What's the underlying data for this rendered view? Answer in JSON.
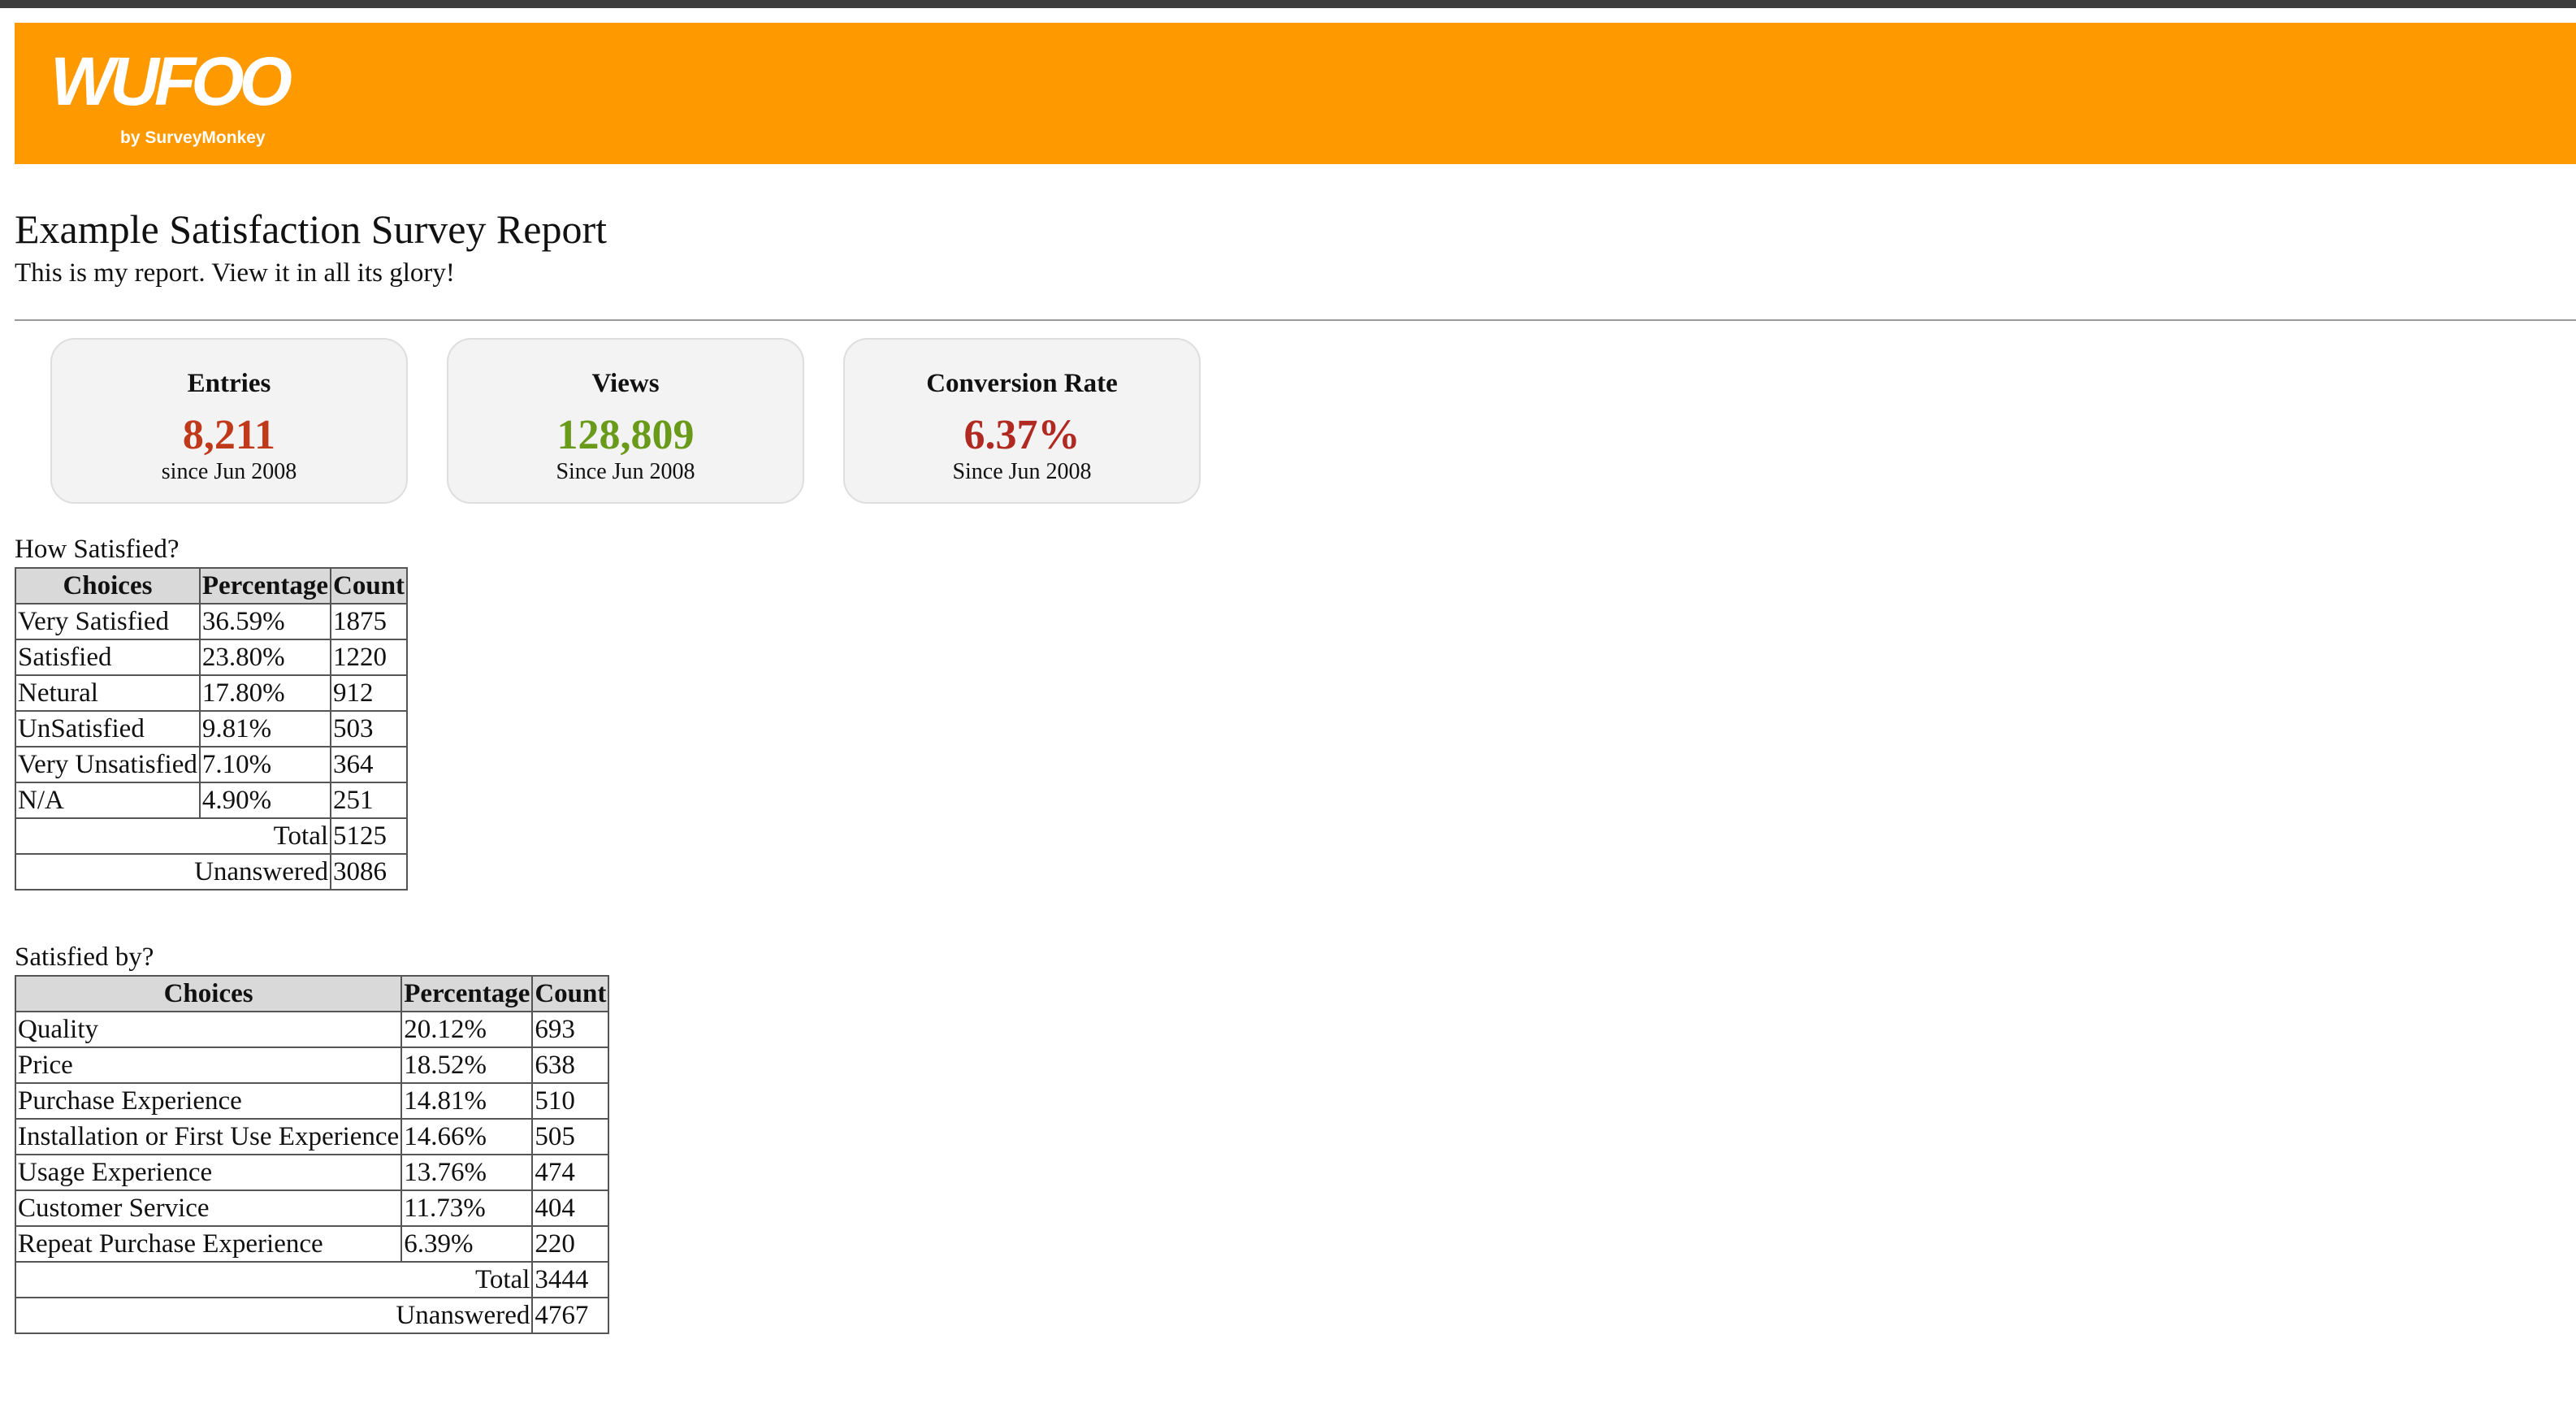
{
  "colors": {
    "header_bg": "#ff9900",
    "entries": "#c0391b",
    "views": "#6a9a1a",
    "conversion": "#b02a22"
  },
  "header": {
    "logo_text": "WUFOO",
    "logo_sub": "by SurveyMonkey"
  },
  "report": {
    "title": "Example Satisfaction Survey Report",
    "description": "This is my report. View it in all its glory!"
  },
  "stats": [
    {
      "label": "Entries",
      "value": "8,211",
      "since": "since Jun 2008"
    },
    {
      "label": "Views",
      "value": "128,809",
      "since": "Since Jun 2008"
    },
    {
      "label": "Conversion Rate",
      "value": "6.37%",
      "since": "Since Jun 2008"
    }
  ],
  "tables": [
    {
      "caption": "How Satisfied?",
      "headers": [
        "Choices",
        "Percentage",
        "Count"
      ],
      "rows": [
        [
          "Very Satisfied",
          "36.59%",
          "1875"
        ],
        [
          "Satisfied",
          "23.80%",
          "1220"
        ],
        [
          "Netural",
          "17.80%",
          "912"
        ],
        [
          "UnSatisfied",
          "9.81%",
          "503"
        ],
        [
          "Very Unsatisfied",
          "7.10%",
          "364"
        ],
        [
          "N/A",
          "4.90%",
          "251"
        ]
      ],
      "total_label": "Total",
      "total": "5125",
      "unanswered_label": "Unanswered",
      "unanswered": "3086"
    },
    {
      "caption": "Satisfied by?",
      "headers": [
        "Choices",
        "Percentage",
        "Count"
      ],
      "rows": [
        [
          "Quality",
          "20.12%",
          "693"
        ],
        [
          "Price",
          "18.52%",
          "638"
        ],
        [
          "Purchase Experience",
          "14.81%",
          "510"
        ],
        [
          "Installation or First Use Experience",
          "14.66%",
          "505"
        ],
        [
          "Usage Experience",
          "13.76%",
          "474"
        ],
        [
          "Customer Service",
          "11.73%",
          "404"
        ],
        [
          "Repeat Purchase Experience",
          "6.39%",
          "220"
        ]
      ],
      "total_label": "Total",
      "total": "3444",
      "unanswered_label": "Unanswered",
      "unanswered": "4767"
    }
  ]
}
